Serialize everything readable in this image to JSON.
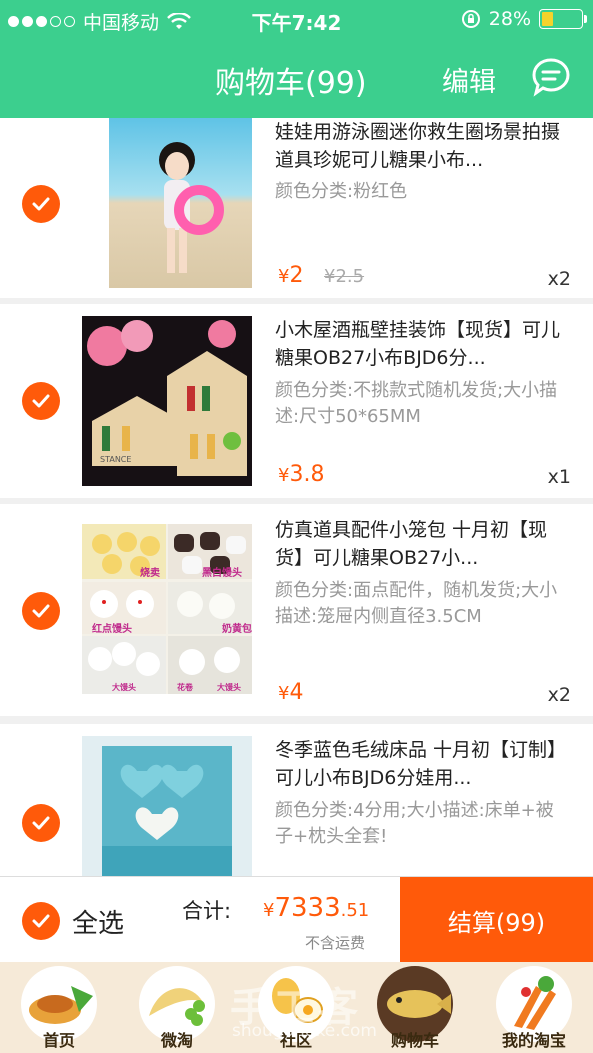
{
  "status": {
    "carrier": "中国移动",
    "time": "下午7:42",
    "battery": "28%",
    "battery_level": 0.28
  },
  "nav": {
    "title": "购物车(99)",
    "edit_label": "编辑"
  },
  "items": [
    {
      "title": "娃娃用游泳圈迷你救生圈场景拍摄道具珍妮可儿糖果小布...",
      "spec": "颜色分类:粉红色",
      "currency": "¥",
      "price": "2",
      "old_price": "¥2.5",
      "qty": "x2"
    },
    {
      "title": "小木屋酒瓶壁挂装饰【现货】可儿糖果OB27小布BJD6分...",
      "spec": "颜色分类:不挑款式随机发货;大小描述:尺寸50*65MM",
      "currency": "¥",
      "price": "3.8",
      "qty": "x1",
      "image_text": "STANCE"
    },
    {
      "title": "仿真道具配件小笼包 十月初【现货】可儿糖果OB27小...",
      "spec": "颜色分类:面点配件，随机发货;大小描述:笼屉内侧直径3.5CM",
      "currency": "¥",
      "price": "4",
      "qty": "x2",
      "image_labels": [
        "烧卖",
        "黑白馒头",
        "红点馒头",
        "奶黄包",
        "大馒头",
        "花卷",
        "大馒头"
      ]
    },
    {
      "title": "冬季蓝色毛绒床品 十月初【订制】可儿小布BJD6分娃用...",
      "spec": "颜色分类:4分用;大小描述:床单+被子+枕头全套!"
    }
  ],
  "bottom": {
    "select_all": "全选",
    "total_label": "合计:",
    "total_currency": "¥",
    "total_int": "7333",
    "total_dec": ".51",
    "shipping_note": "不含运费",
    "checkout": "结算(99)"
  },
  "tabs": [
    {
      "label": "首页",
      "icon": "home-food-icon"
    },
    {
      "label": "微淘",
      "icon": "weitao-food-icon"
    },
    {
      "label": "社区",
      "icon": "community-food-icon"
    },
    {
      "label": "购物车",
      "icon": "cart-food-icon"
    },
    {
      "label": "我的淘宝",
      "icon": "my-taobao-food-icon"
    }
  ],
  "watermark": {
    "text": "手工客",
    "sub": "shougongke.com"
  },
  "colors": {
    "brand": "#3ccf8e",
    "accent": "#ff5a0a"
  }
}
